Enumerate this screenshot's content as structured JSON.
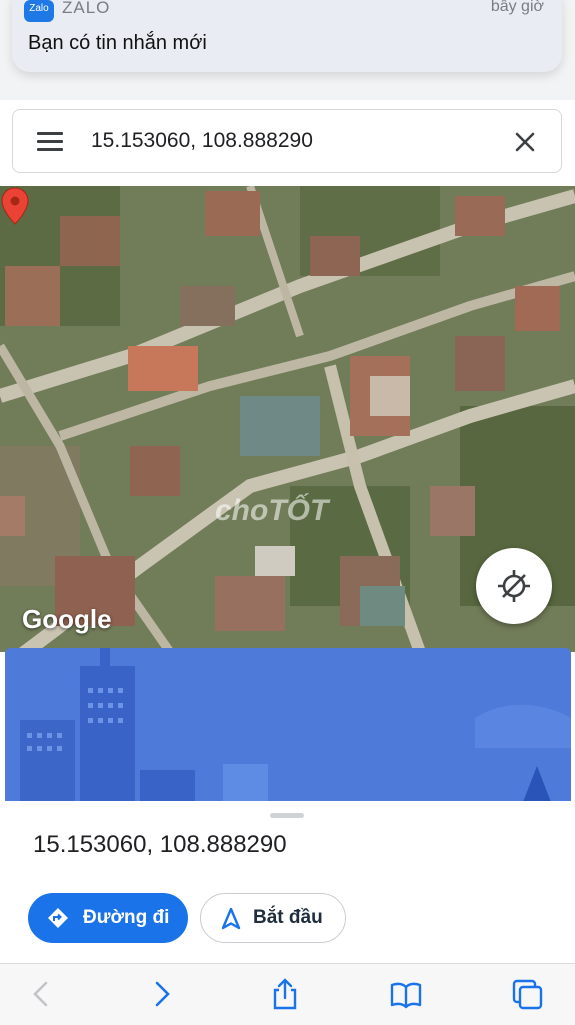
{
  "notification": {
    "app_name": "ZALO",
    "app_icon_text": "Zalo",
    "time": "bây giờ",
    "message": "Bạn có tin nhắn mới"
  },
  "search": {
    "value": "15.153060, 108.888290"
  },
  "map": {
    "google_label": "Google",
    "watermark": "choTỐT"
  },
  "place": {
    "coordinates": "15.153060, 108.888290"
  },
  "actions": {
    "directions_label": "Đường đi",
    "start_label": "Bắt đầu"
  },
  "colors": {
    "accent": "#1a73e8",
    "banner": "#4e7ad9",
    "pin": "#ea4335"
  },
  "icons": {
    "menu": "menu-icon",
    "close": "close-icon",
    "locate": "my-location-icon",
    "back": "back-icon",
    "forward": "forward-icon",
    "share": "share-icon",
    "bookmarks": "bookmarks-icon",
    "tabs": "tabs-icon"
  }
}
